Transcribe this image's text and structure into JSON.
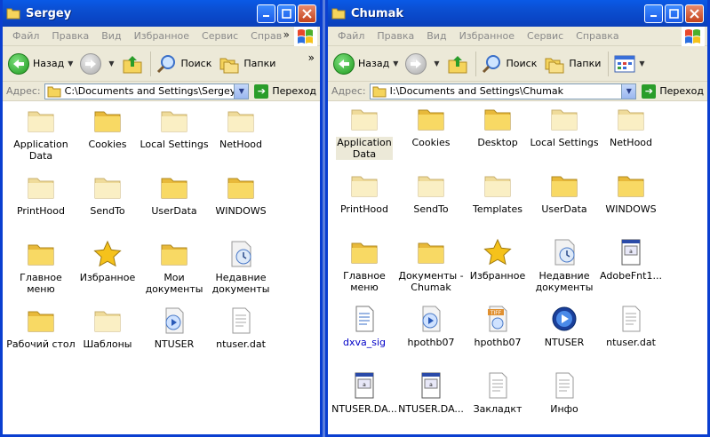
{
  "colors": {
    "title_blue": "#0b4ed0",
    "chrome": "#ece9d8",
    "folder": "#f5d45c",
    "go_green": "#2a9d2a"
  },
  "left": {
    "title": "Sergey",
    "menu": [
      "Файл",
      "Правка",
      "Вид",
      "Избранное",
      "Сервис",
      "Справ"
    ],
    "toolbar": {
      "back": "Назад",
      "search": "Поиск",
      "folders": "Папки"
    },
    "address_label": "Адрес:",
    "address": "C:\\Documents and Settings\\Sergey",
    "go": "Переход",
    "items": [
      {
        "label": "Application\nData",
        "icon": "folder-pale-icon"
      },
      {
        "label": "Cookies",
        "icon": "folder-icon"
      },
      {
        "label": "Local Settings",
        "icon": "folder-pale-icon"
      },
      {
        "label": "NetHood",
        "icon": "folder-pale-icon"
      },
      {
        "label": "PrintHood",
        "icon": "folder-pale-icon"
      },
      {
        "label": "SendTo",
        "icon": "folder-pale-icon"
      },
      {
        "label": "UserData",
        "icon": "folder-icon"
      },
      {
        "label": "WINDOWS",
        "icon": "folder-icon"
      },
      {
        "label": "Главное\nменю",
        "icon": "folder-icon"
      },
      {
        "label": "Избранное",
        "icon": "star-icon"
      },
      {
        "label": "Мои\nдокументы",
        "icon": "folder-icon"
      },
      {
        "label": "Недавние\nдокументы",
        "icon": "recent-docs-icon"
      },
      {
        "label": "Рабочий стол",
        "icon": "folder-icon"
      },
      {
        "label": "Шаблоны",
        "icon": "folder-pale-icon"
      },
      {
        "label": "NTUSER",
        "icon": "media-file-icon"
      },
      {
        "label": "ntuser.dat",
        "icon": "text-file-icon"
      }
    ]
  },
  "right": {
    "title": "Chumak",
    "menu": [
      "Файл",
      "Правка",
      "Вид",
      "Избранное",
      "Сервис",
      "Справка"
    ],
    "toolbar": {
      "back": "Назад",
      "search": "Поиск",
      "folders": "Папки"
    },
    "address_label": "Адрес:",
    "address": "I:\\Documents and Settings\\Chumak",
    "go": "Переход",
    "items": [
      {
        "label": "Application\nData",
        "icon": "folder-pale-icon",
        "selected": true
      },
      {
        "label": "Cookies",
        "icon": "folder-icon"
      },
      {
        "label": "Desktop",
        "icon": "folder-icon"
      },
      {
        "label": "Local Settings",
        "icon": "folder-pale-icon"
      },
      {
        "label": "NetHood",
        "icon": "folder-pale-icon"
      },
      {
        "label": "PrintHood",
        "icon": "folder-pale-icon"
      },
      {
        "label": "SendTo",
        "icon": "folder-pale-icon"
      },
      {
        "label": "Templates",
        "icon": "folder-pale-icon"
      },
      {
        "label": "UserData",
        "icon": "folder-icon"
      },
      {
        "label": "WINDOWS",
        "icon": "folder-icon"
      },
      {
        "label": "Главное\nменю",
        "icon": "folder-icon"
      },
      {
        "label": "Документы -\nChumak",
        "icon": "folder-icon"
      },
      {
        "label": "Избранное",
        "icon": "star-icon"
      },
      {
        "label": "Недавние\nдокументы",
        "icon": "recent-docs-icon"
      },
      {
        "label": "AdobeFnt1...",
        "icon": "system-file-icon"
      },
      {
        "label": "dxva_sig",
        "icon": "doc-file-icon",
        "blue": true
      },
      {
        "label": "hpothb07",
        "icon": "media-file-icon"
      },
      {
        "label": "hpothb07",
        "icon": "tiff-file-icon"
      },
      {
        "label": "NTUSER",
        "icon": "media-player-icon"
      },
      {
        "label": "ntuser.dat",
        "icon": "text-file-icon"
      },
      {
        "label": "NTUSER.DA...",
        "icon": "system-file-icon"
      },
      {
        "label": "NTUSER.DA...",
        "icon": "system-file-icon"
      },
      {
        "label": "Закладкт",
        "icon": "text-file-icon"
      },
      {
        "label": "Инфо",
        "icon": "text-file-icon"
      }
    ]
  }
}
